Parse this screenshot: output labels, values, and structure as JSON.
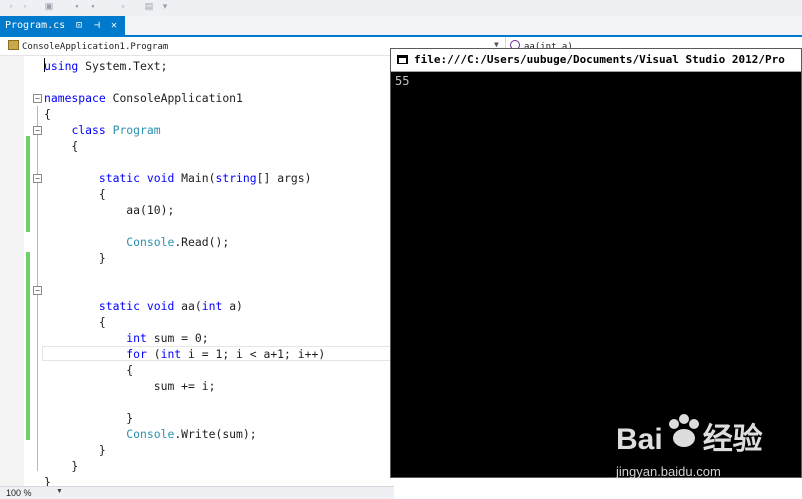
{
  "tab": {
    "label": "Program.cs",
    "pin_icon": "pin-icon",
    "close_icon": "close-icon"
  },
  "nav": {
    "class_selector": "ConsoleApplication1.Program",
    "member_selector": "aa(int a)"
  },
  "code_lines": [
    [
      {
        "t": "using",
        "c": "kw"
      },
      {
        "t": " System.Text;"
      }
    ],
    [],
    [
      {
        "t": "namespace",
        "c": "kw"
      },
      {
        "t": " ConsoleApplication1"
      }
    ],
    [
      {
        "t": "{"
      }
    ],
    [
      {
        "t": "    "
      },
      {
        "t": "class",
        "c": "kw"
      },
      {
        "t": " "
      },
      {
        "t": "Program",
        "c": "ty"
      }
    ],
    [
      {
        "t": "    {"
      }
    ],
    [],
    [
      {
        "t": "        "
      },
      {
        "t": "static",
        "c": "kw"
      },
      {
        "t": " "
      },
      {
        "t": "void",
        "c": "kw"
      },
      {
        "t": " Main("
      },
      {
        "t": "string",
        "c": "kw"
      },
      {
        "t": "[] args)"
      }
    ],
    [
      {
        "t": "        {"
      }
    ],
    [
      {
        "t": "            aa(10);"
      }
    ],
    [],
    [
      {
        "t": "            "
      },
      {
        "t": "Console",
        "c": "ty"
      },
      {
        "t": ".Read();"
      }
    ],
    [
      {
        "t": "        }"
      }
    ],
    [],
    [],
    [
      {
        "t": "        "
      },
      {
        "t": "static",
        "c": "kw"
      },
      {
        "t": " "
      },
      {
        "t": "void",
        "c": "kw"
      },
      {
        "t": " aa("
      },
      {
        "t": "int",
        "c": "kw"
      },
      {
        "t": " a)"
      }
    ],
    [
      {
        "t": "        {"
      }
    ],
    [
      {
        "t": "            "
      },
      {
        "t": "int",
        "c": "kw"
      },
      {
        "t": " sum = 0;"
      }
    ],
    [
      {
        "t": "            "
      },
      {
        "t": "for",
        "c": "kw"
      },
      {
        "t": " ("
      },
      {
        "t": "int",
        "c": "kw"
      },
      {
        "t": " i = 1; i < a+1; i++)"
      }
    ],
    [
      {
        "t": "            {"
      }
    ],
    [
      {
        "t": "                sum += i;"
      }
    ],
    [],
    [
      {
        "t": "            }"
      }
    ],
    [
      {
        "t": "            "
      },
      {
        "t": "Console",
        "c": "ty"
      },
      {
        "t": ".Write(sum);"
      }
    ],
    [
      {
        "t": "        }"
      }
    ],
    [
      {
        "t": "    }"
      }
    ],
    [
      {
        "t": "}"
      }
    ]
  ],
  "console": {
    "title": "file:///C:/Users/uubuge/Documents/Visual Studio 2012/Pro",
    "output": "55"
  },
  "status": {
    "zoom": "100 %"
  },
  "watermark": {
    "brand": "Bai",
    "brand2": "经验",
    "url": "jingyan.baidu.com"
  }
}
